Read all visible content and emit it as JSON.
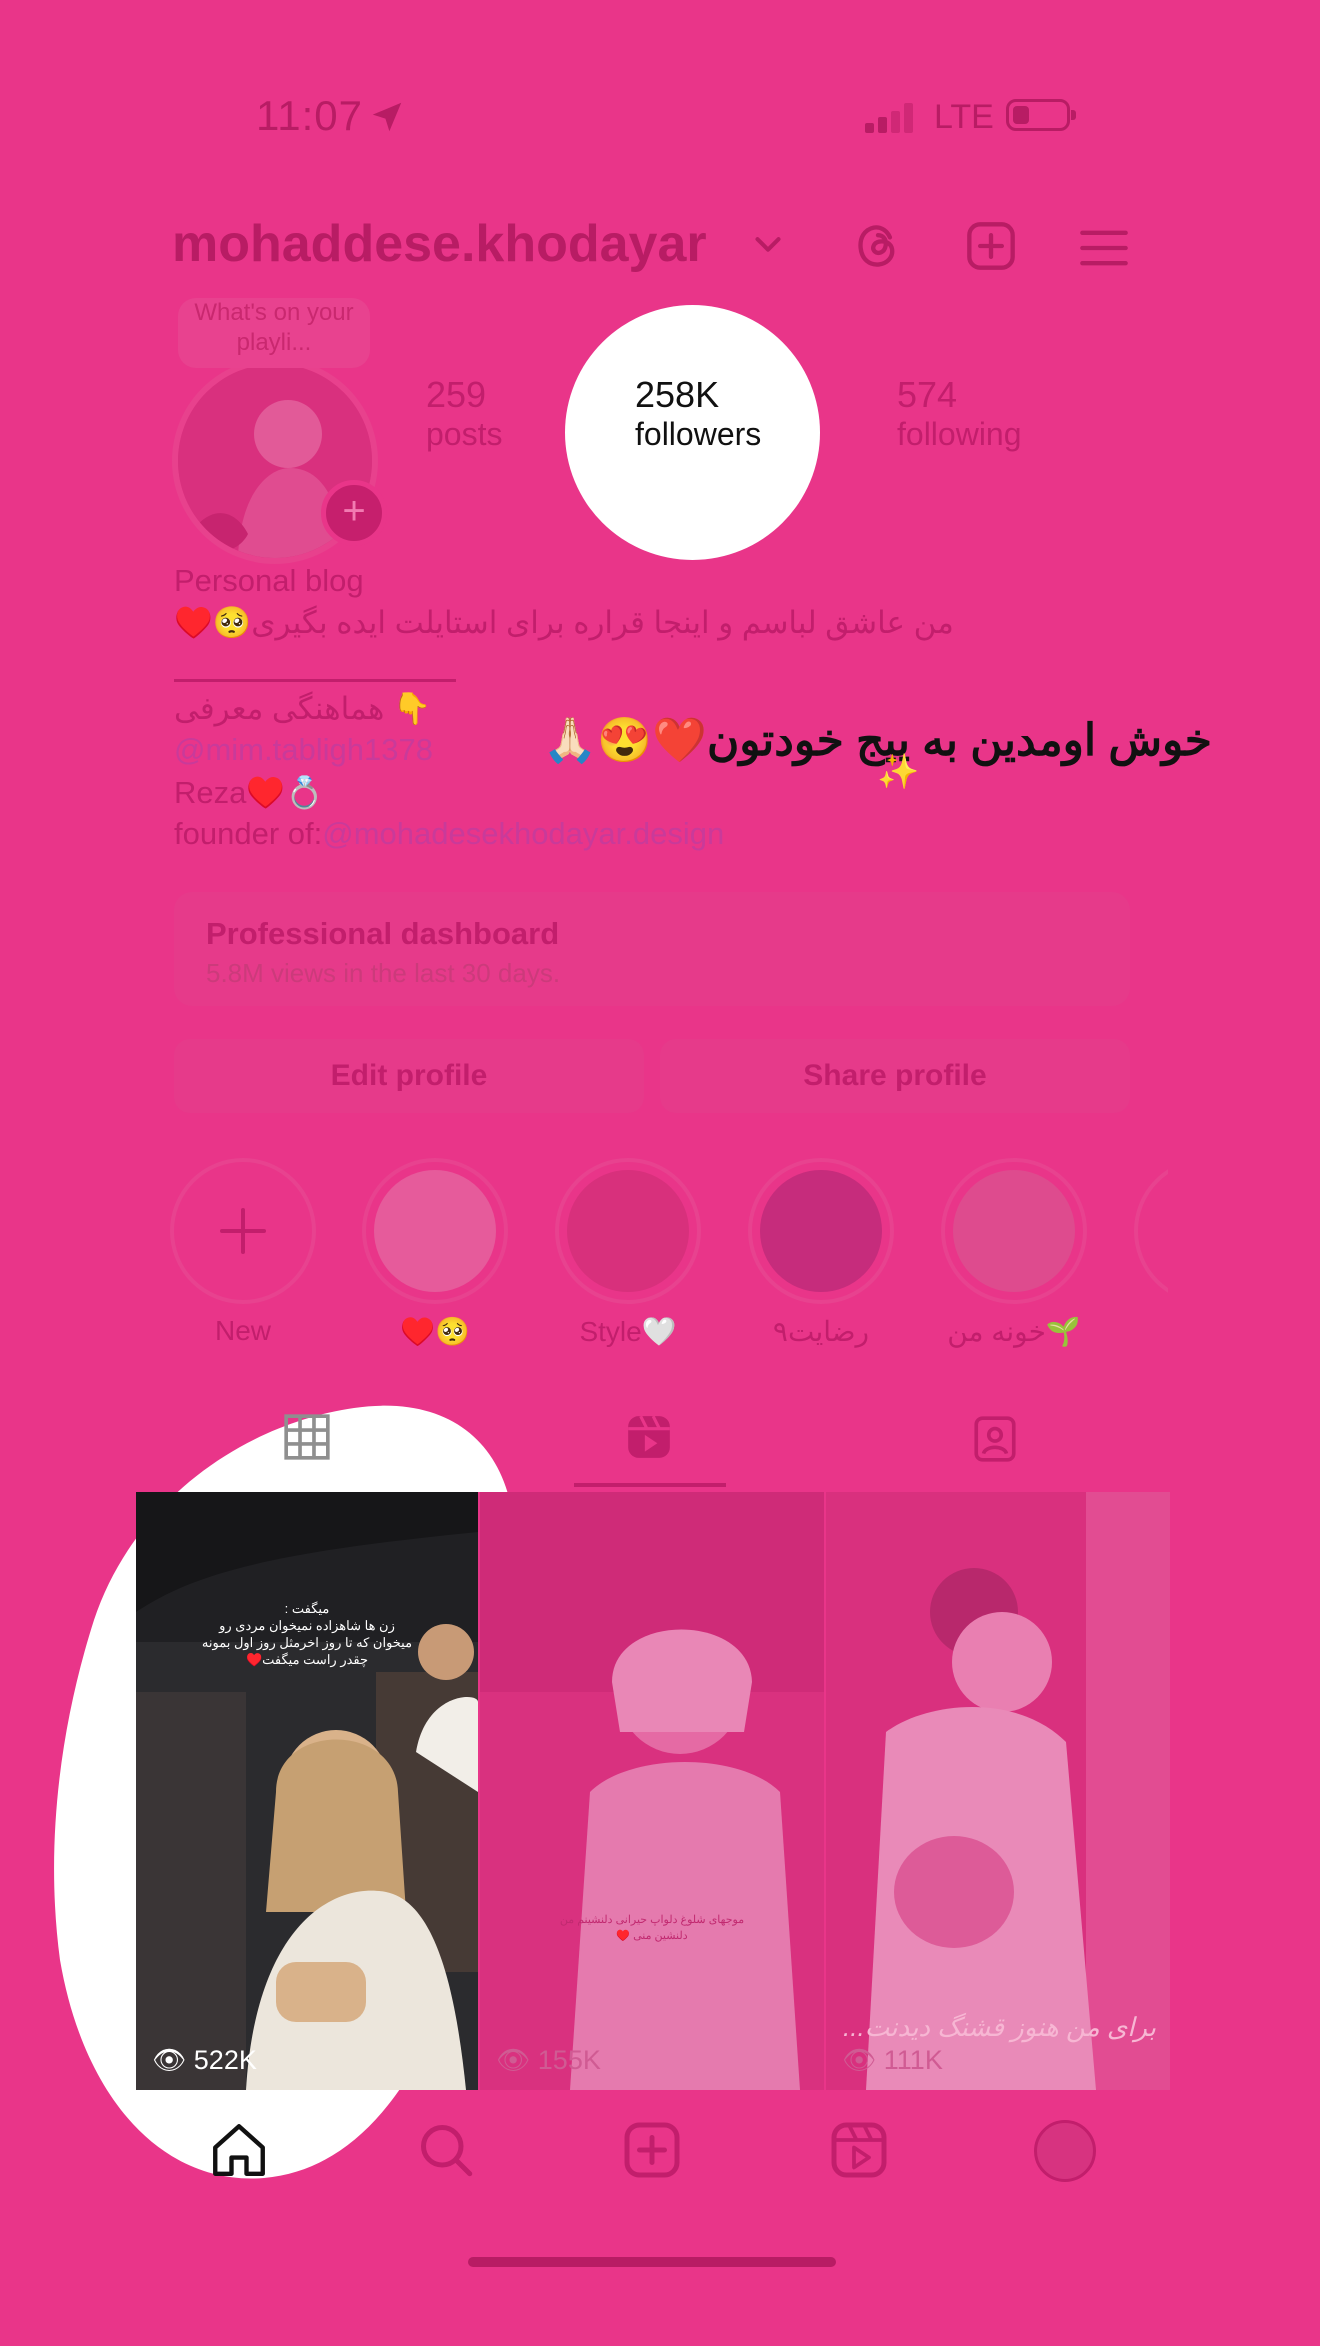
{
  "status_bar": {
    "time": "11:07",
    "network": "LTE",
    "icons": [
      "location-arrow-icon",
      "signal-icon",
      "battery-icon"
    ]
  },
  "header": {
    "username": "mohaddese.khodayar",
    "icons": [
      "chevron-down-icon",
      "threads-icon",
      "plus-square-icon",
      "menu-icon"
    ]
  },
  "profile": {
    "note": "What's on your playli...",
    "stats": [
      {
        "value": "259",
        "label": "posts"
      },
      {
        "value": "258K",
        "label": "followers"
      },
      {
        "value": "574",
        "label": "following"
      }
    ],
    "category": "Personal blog",
    "bio_line1": "من عاشق لباسم و اینجا قراره برای استایلت ایده بگیری🥺♥️",
    "bio_line2": "👇 هماهنگی معرفی",
    "bio_line3": "@mim.tabligh1378",
    "bio_line4": "Reza♥️💍",
    "bio_line5_prefix": "founder of:",
    "bio_line5_link": "@mohadesekhodayar.design",
    "overlay_text": "خوش اومدین به پیج خودتون❤️😍🙏🏻",
    "sparkle": "✨"
  },
  "dashboard": {
    "title": "Professional dashboard",
    "subtitle": "5.8M views in the last 30 days."
  },
  "buttons": {
    "edit": "Edit profile",
    "share": "Share profile"
  },
  "highlights": [
    {
      "label": "New"
    },
    {
      "label": "♥️🥺"
    },
    {
      "label": "Style🤍"
    },
    {
      "label": "رضایت۹"
    },
    {
      "label": "خونه من🌱"
    }
  ],
  "tabs": [
    "grid-icon",
    "reels-icon",
    "tagged-icon"
  ],
  "grid": [
    {
      "views": "522K",
      "caption": "میگفت :\nزن ها شاهزاده نمیخوان مردی رو\nمیخوان که تا روز اخرمثل روز اول بمونه\nچقدر راست میگفت♥️"
    },
    {
      "views": "155K",
      "caption": "موجهای شلوغ دلواپ حیرانی دلنشینم من\nدلنشین منی ♥️"
    },
    {
      "views": "111K",
      "caption": "برای من هنوز قشنگ دیدنت..."
    }
  ],
  "bottom_nav": [
    "home-icon",
    "search-icon",
    "create-icon",
    "reels-icon",
    "profile-avatar"
  ],
  "colors": {
    "background": "#E93589",
    "dim_text": "#C21E6C",
    "highlight_white": "#FFFFFF"
  }
}
